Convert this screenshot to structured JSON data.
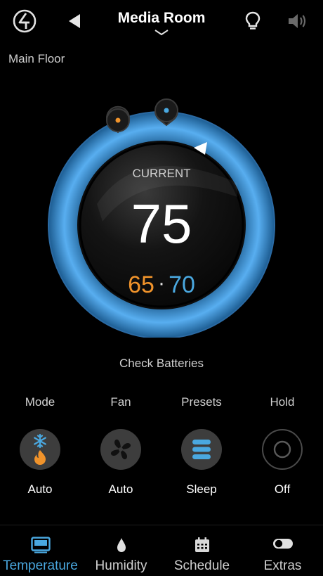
{
  "header": {
    "title": "Media Room",
    "icons": [
      "logo-icon",
      "back-icon",
      "lightbulb-icon",
      "speaker-icon"
    ]
  },
  "location": "Main Floor",
  "thermostat": {
    "current_label": "CURRENT",
    "current_temp": "75",
    "heat_setpoint": "65",
    "separator": "·",
    "cool_setpoint": "70",
    "heat_color": "#f0932b",
    "cool_color": "#4aa8e0",
    "ring_color": "#3b8fd0"
  },
  "status": "Check Batteries",
  "controls": [
    {
      "label": "Mode",
      "value": "Auto",
      "icon": "snowflake-flame-icon"
    },
    {
      "label": "Fan",
      "value": "Auto",
      "icon": "fan-icon"
    },
    {
      "label": "Presets",
      "value": "Sleep",
      "icon": "presets-icon"
    },
    {
      "label": "Hold",
      "value": "Off",
      "icon": "hold-off-icon"
    }
  ],
  "tabs": [
    {
      "label": "Temperature",
      "icon": "thermostat-icon",
      "active": true
    },
    {
      "label": "Humidity",
      "icon": "droplet-icon",
      "active": false
    },
    {
      "label": "Schedule",
      "icon": "calendar-icon",
      "active": false
    },
    {
      "label": "Extras",
      "icon": "toggle-icon",
      "active": false
    }
  ]
}
